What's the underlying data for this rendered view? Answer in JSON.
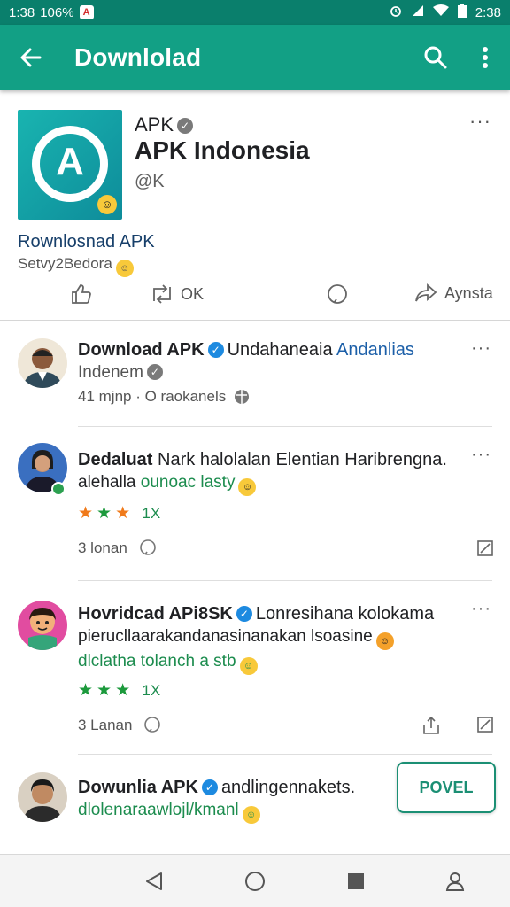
{
  "status_bar": {
    "time_left": "1:38",
    "battery_pct": "106%",
    "notif_icon_glyph": "A",
    "time_right": "2:38"
  },
  "app_bar": {
    "title": "Downlolad",
    "icons": [
      "back-arrow-icon",
      "search-icon",
      "more-vert-icon"
    ],
    "color": "#12a085"
  },
  "header": {
    "small_name": "APK",
    "name": "APK Indonesia",
    "handle": "@K",
    "logo_text": "A",
    "link": "Rownlosnad APK",
    "sub": "Setvy2Bedora",
    "more": "···",
    "actions": {
      "ok_label": "OK",
      "share_label": "Aynsta"
    }
  },
  "feed": [
    {
      "name": "Download APK",
      "text": "Undahaneaia",
      "link_text": "Andanlias",
      "line2": "Indenem",
      "meta": "41 mjnp · O raokanels"
    },
    {
      "name": "Dedaluat",
      "text": "Nark halolalan Elentian Haribrengna.",
      "line2": "alehalla",
      "line2_green": "ounoac lasty",
      "rating": 3,
      "rating_label": "1X",
      "foot": "3 lonan"
    },
    {
      "name": "Hovridcad APi8SK",
      "text": "Lonresihana kolokama",
      "line2": "pierucllaarakandanasinanakan lsoasine",
      "line3": "dlclatha tolanch a stb",
      "rating": 3,
      "rating_label": "1X",
      "foot": "3 Lanan"
    },
    {
      "name": "Dowunlia APK",
      "text": "andlingennakets.",
      "line2": "dlolenaraawlojl/kmanl",
      "follow_label": "POVEL"
    }
  ],
  "nav": {
    "icons": [
      "nav-back-icon",
      "nav-home-icon",
      "nav-recents-icon",
      "nav-profile-icon"
    ]
  }
}
